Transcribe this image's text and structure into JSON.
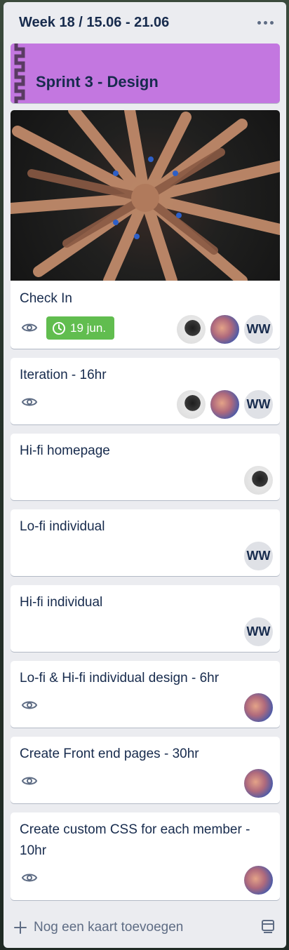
{
  "list": {
    "title": "Week 18 / 15.06 - 21.06",
    "menu_icon": "ellipsis-icon"
  },
  "cards": {
    "sprint": {
      "title": "Sprint 3 - Design",
      "color": "#c377e0"
    },
    "check_in": {
      "title": "Check In",
      "due": "19 jun.",
      "due_color": "#61bd4f",
      "members": [
        "photo-1",
        "photo-2",
        "WW"
      ]
    },
    "iteration": {
      "title": "Iteration - 16hr",
      "members": [
        "photo-1",
        "photo-2",
        "WW"
      ]
    },
    "hifi_homepage": {
      "title": "Hi-fi homepage",
      "members": [
        "photo-1"
      ]
    },
    "lofi_individual": {
      "title": "Lo-fi individual",
      "members": [
        "WW"
      ]
    },
    "hifi_individual": {
      "title": "Hi-fi individual",
      "members": [
        "WW"
      ]
    },
    "lofi_hifi_design": {
      "title": "Lo-fi & Hi-fi individual design - 6hr",
      "members": [
        "photo-2"
      ]
    },
    "front_end": {
      "title": "Create Front end pages - 30hr",
      "members": [
        "photo-2"
      ]
    },
    "custom_css": {
      "title_line1": "Create custom CSS for each member -",
      "title_line2": "10hr",
      "members": [
        "photo-2"
      ]
    }
  },
  "avatar_initials": "WW",
  "footer": {
    "add_label": "Nog een kaart toevoegen",
    "add_icon": "plus-icon",
    "template_icon": "card-template-icon"
  }
}
